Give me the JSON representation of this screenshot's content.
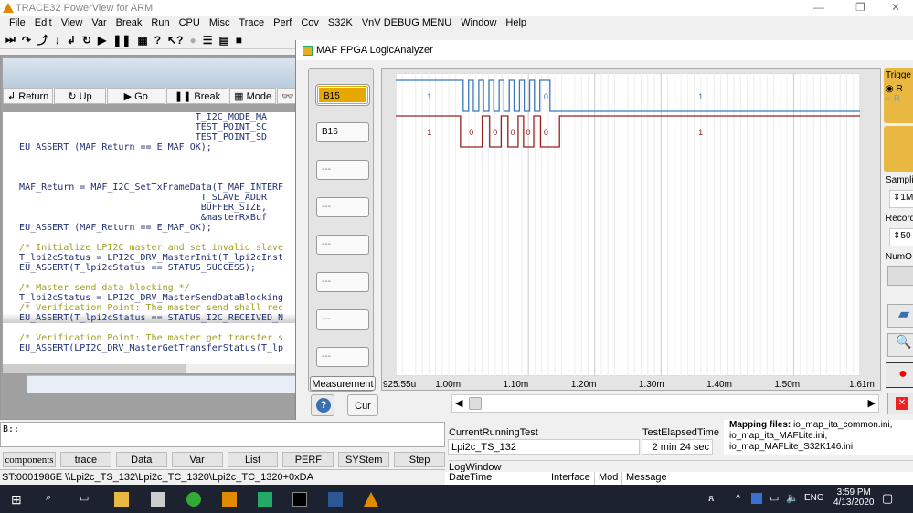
{
  "window_title": "TRACE32 PowerView for ARM",
  "menu": [
    "File",
    "Edit",
    "View",
    "Var",
    "Break",
    "Run",
    "CPU",
    "Misc",
    "Trace",
    "Perf",
    "Cov",
    "S32K",
    "VnV DEBUG MENU",
    "Window",
    "Help"
  ],
  "toolbar_icons": [
    "step-icon",
    "step-over-icon",
    "step-out-icon",
    "down-icon",
    "return-icon",
    "up-icon",
    "go-icon",
    "break-icon",
    "mode-icon",
    "help-icon",
    "context-help-icon",
    "stop-icon",
    "list-icon",
    "register-icon",
    "memory-icon"
  ],
  "list_buttons": [
    "Return",
    "Up",
    "Go",
    "Break",
    "Mode"
  ],
  "code_lines": [
    {
      "t": "                                   T_I2C_MODE_MA",
      "c": ""
    },
    {
      "t": "                                   TEST_POINT_SC",
      "c": ""
    },
    {
      "t": "                                   TEST_POINT_SD",
      "c": ""
    },
    {
      "t": "   EU_ASSERT (MAF_Return == E_MAF_OK);",
      "c": ""
    },
    {
      "t": "",
      "c": ""
    },
    {
      "t": "",
      "c": ""
    },
    {
      "t": "",
      "c": ""
    },
    {
      "t": "   MAF_Return = MAF_I2C_SetTxFrameData(T_MAF_INTERF",
      "c": ""
    },
    {
      "t": "                                    T_SLAVE_ADDR",
      "c": ""
    },
    {
      "t": "                                    BUFFER_SIZE,",
      "c": ""
    },
    {
      "t": "                                    &masterRxBuf",
      "c": ""
    },
    {
      "t": "   EU_ASSERT (MAF_Return == E_MAF_OK);",
      "c": ""
    },
    {
      "t": "",
      "c": ""
    },
    {
      "t": "   /* Initialize LPI2C master and set invalid slave",
      "c": "cm"
    },
    {
      "t": "   T_lpi2cStatus = LPI2C_DRV_MasterInit(T_lpi2cInst",
      "c": ""
    },
    {
      "t": "   EU_ASSERT(T_lpi2cStatus == STATUS_SUCCESS);",
      "c": ""
    },
    {
      "t": "",
      "c": ""
    },
    {
      "t": "   /* Master send data blocking */",
      "c": "cm"
    },
    {
      "t": "   T_lpi2cStatus = LPI2C_DRV_MasterSendDataBlocking",
      "c": ""
    },
    {
      "t": "   /* Verification Point: The master send shall rec",
      "c": "cm"
    },
    {
      "t": "   EU_ASSERT(T_lpi2cStatus == STATUS_I2C_RECEIVED_N",
      "c": "hl"
    },
    {
      "t": "",
      "c": ""
    },
    {
      "t": "   /* Verification Point: The master get transfer s",
      "c": "cm"
    },
    {
      "t": "   EU_ASSERT(LPI2C_DRV_MasterGetTransferStatus(T_lp",
      "c": ""
    }
  ],
  "command_prompt": "B::",
  "softkeys": [
    "components",
    "trace",
    "Data",
    "Var",
    "List",
    "PERF",
    "SYStem",
    "Step"
  ],
  "status_line": "ST:0001986E  \\\\Lpi2c_TS_132\\Lpi2c_TC_1320\\Lpi2c_TC_1320+0xDA",
  "la": {
    "title": "MAF FPGA LogicAnalyzer",
    "channels": [
      "B15",
      "B16",
      "---",
      "---",
      "---",
      "---",
      "---",
      "---"
    ],
    "measurement": "Measurement",
    "cur": "Cur",
    "right": {
      "trigger": "Trigge",
      "sampling": "Samplin",
      "record": "Record",
      "numo": "NumO",
      "sampling_val": "1M",
      "record_val": "50"
    }
  },
  "chart_data": {
    "type": "line",
    "xlim": [
      0.92555,
      1.61
    ],
    "x_unit": "ms",
    "tick_labels": [
      "925.55u",
      "1.00m",
      "1.10m",
      "1.20m",
      "1.30m",
      "1.40m",
      "1.50m",
      "1.61m"
    ],
    "tick_values": [
      0.92555,
      1.0,
      1.1,
      1.2,
      1.3,
      1.4,
      1.5,
      1.61
    ],
    "series": [
      {
        "name": "B15",
        "color": "#3a7ab8",
        "initial": 1,
        "transitions": [
          1.025,
          1.033,
          1.04,
          1.048,
          1.055,
          1.063,
          1.07,
          1.078,
          1.085,
          1.093,
          1.1,
          1.108,
          1.115,
          1.123,
          1.13,
          1.138,
          1.153
        ],
        "labels": [
          {
            "x": 0.975,
            "v": "1"
          },
          {
            "x": 1.147,
            "v": "0"
          },
          {
            "x": 1.375,
            "v": "1"
          }
        ]
      },
      {
        "name": "B16",
        "color": "#9a2020",
        "initial": 1,
        "transitions": [
          1.021,
          1.053,
          1.064,
          1.081,
          1.091,
          1.106,
          1.114,
          1.129,
          1.139,
          1.167
        ],
        "labels": [
          {
            "x": 0.975,
            "v": "1"
          },
          {
            "x": 1.037,
            "v": "0"
          },
          {
            "x": 1.072,
            "v": "0"
          },
          {
            "x": 1.098,
            "v": "0"
          },
          {
            "x": 1.121,
            "v": "0"
          },
          {
            "x": 1.147,
            "v": "0"
          },
          {
            "x": 1.375,
            "v": "1"
          }
        ]
      }
    ]
  },
  "bottom": {
    "current_test_label": "CurrentRunningTest",
    "current_test": "Lpi2c_TS_132",
    "elapsed_label": "TestElapsedTime",
    "elapsed": "2 min 24 sec",
    "mapping_title": "Mapping files:",
    "mapping": [
      "io_map_ita_common.ini,",
      "io_map_ita_MAFLite.ini,",
      "io_map_MAFLite_S32K146.ini"
    ],
    "log_title": "LogWindow",
    "log_cols": [
      "DateTime",
      "Interface",
      "Mod",
      "Message"
    ]
  },
  "taskbar": {
    "time": "3:59 PM",
    "date": "4/13/2020",
    "lang": "ENG"
  }
}
